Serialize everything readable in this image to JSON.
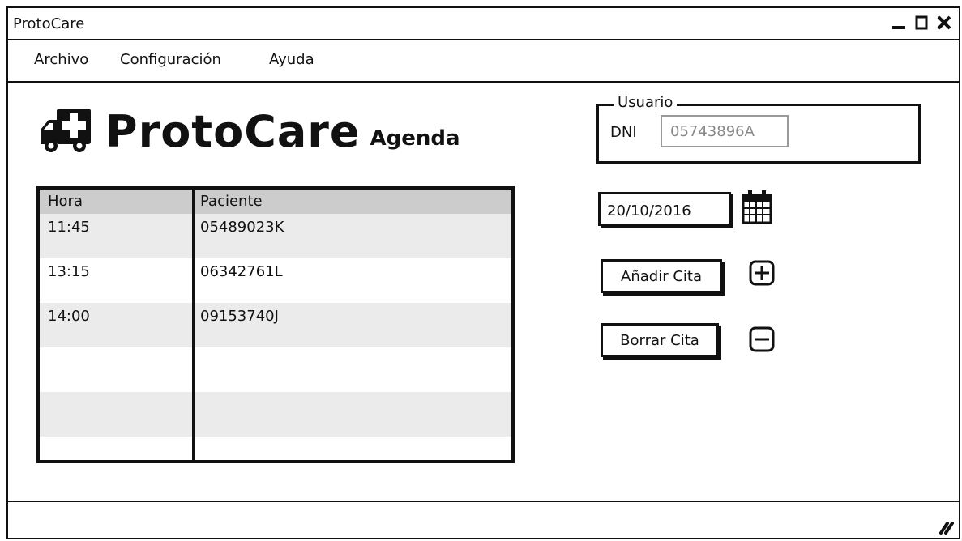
{
  "window": {
    "title": "ProtoCare"
  },
  "menu": {
    "items": [
      "Archivo",
      "Configuración",
      "Ayuda"
    ]
  },
  "header": {
    "app_name": "ProtoCare",
    "subtitle": "Agenda",
    "logo_icon": "ambulance-icon"
  },
  "schedule": {
    "columns": [
      "Hora",
      "Paciente"
    ],
    "rows": [
      {
        "hora": "11:45",
        "paciente": "05489023K"
      },
      {
        "hora": "13:15",
        "paciente": "06342761L"
      },
      {
        "hora": "14:00",
        "paciente": "09153740J"
      },
      {
        "hora": "",
        "paciente": ""
      },
      {
        "hora": "",
        "paciente": ""
      },
      {
        "hora": "",
        "paciente": ""
      }
    ]
  },
  "user": {
    "legend": "Usuario",
    "dni_label": "DNI",
    "dni_value": "05743896A"
  },
  "date": {
    "value": "20/10/2016",
    "icon": "calendar-icon"
  },
  "actions": {
    "add_label": "Añadir Cita",
    "add_icon": "plus-icon",
    "delete_label": "Borrar Cita",
    "delete_icon": "minus-icon"
  },
  "colors": {
    "header_bg": "#cccccc",
    "row_alt": "#ebebeb",
    "border": "#111111"
  }
}
